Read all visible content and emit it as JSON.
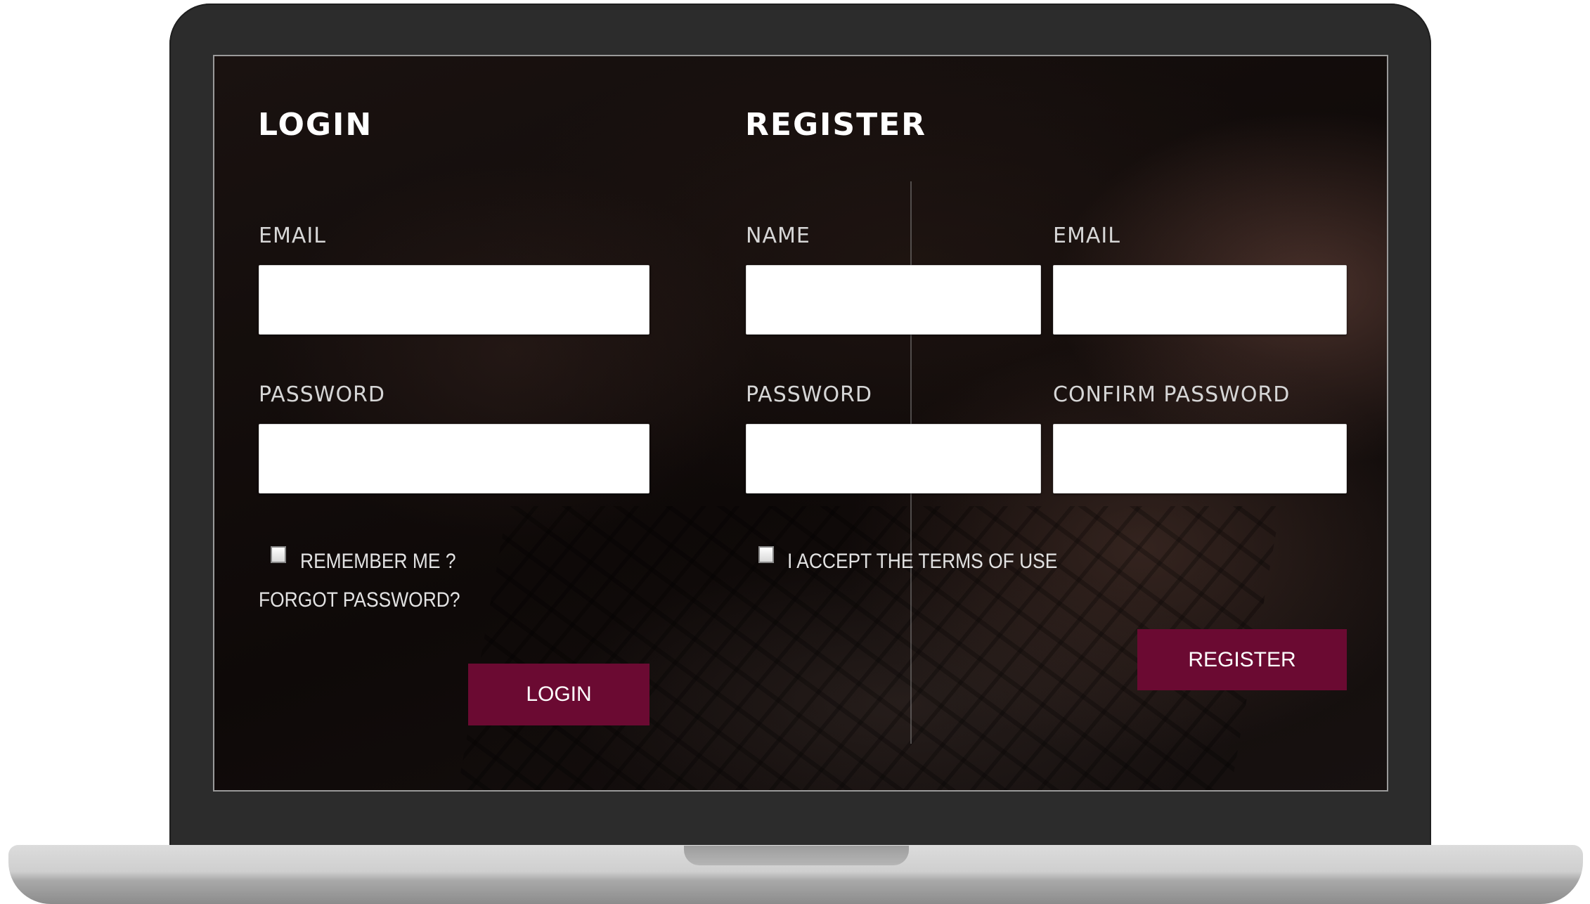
{
  "login": {
    "heading": "LOGIN",
    "email_label": "EMAIL",
    "email_value": "",
    "password_label": "PASSWORD",
    "password_value": "",
    "remember_label": "REMEMBER ME ?",
    "forgot_link": "FORGOT PASSWORD?",
    "button_label": "LOGIN"
  },
  "register": {
    "heading": "REGISTER",
    "name_label": "NAME",
    "name_value": "",
    "email_label": "EMAIL",
    "email_value": "",
    "password_label": "PASSWORD",
    "password_value": "",
    "confirm_label": "CONFIRM PASSWORD",
    "confirm_value": "",
    "terms_label": "I ACCEPT THE TERMS OF USE",
    "button_label": "REGISTER"
  },
  "colors": {
    "button": "#6b0a32",
    "laptop_bezel": "#2c2c2c",
    "heading_text": "#ffffff"
  }
}
